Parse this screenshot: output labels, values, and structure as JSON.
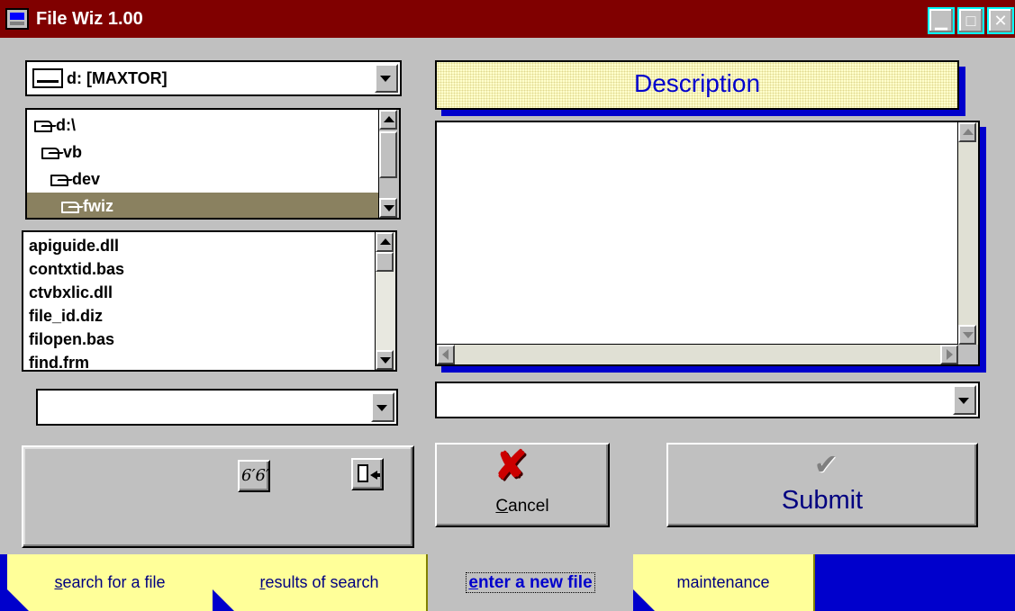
{
  "window": {
    "title": "File Wiz 1.00"
  },
  "drive_combo": {
    "value": "d: [MAXTOR]"
  },
  "directories": [
    {
      "label": "d:\\",
      "level": 0,
      "selected": false
    },
    {
      "label": "vb",
      "level": 1,
      "selected": false
    },
    {
      "label": "dev",
      "level": 2,
      "selected": false
    },
    {
      "label": "fwiz",
      "level": 3,
      "selected": true
    }
  ],
  "files": [
    "apiguide.dll",
    "contxtid.bas",
    "ctvbxlic.dll",
    "file_id.diz",
    "filopen.bas",
    "find.frm"
  ],
  "pattern_combo": {
    "value": ""
  },
  "description": {
    "label": "Description",
    "value": ""
  },
  "category_combo": {
    "value": ""
  },
  "toolbar": {
    "view_icon": "glasses-icon",
    "exit_icon": "exit-door-icon"
  },
  "buttons": {
    "cancel": {
      "label": "Cancel",
      "underline": "C",
      "rest": "ancel",
      "icon": "red-x-icon"
    },
    "submit": {
      "label": "Submit",
      "icon": "checkmark-icon"
    }
  },
  "tabs": [
    {
      "underline": "s",
      "rest": "earch for a file",
      "active": false
    },
    {
      "underline": "r",
      "rest": "esults of search",
      "active": false
    },
    {
      "underline": "e",
      "rest": "nter a new file",
      "active": true
    },
    {
      "underline": "",
      "rest": "maintenance",
      "active": false
    }
  ],
  "colors": {
    "title_bar": "#800000",
    "accent_blue": "#0000cc",
    "tab_yellow": "#ffff99",
    "cancel_red": "#cc0000"
  }
}
